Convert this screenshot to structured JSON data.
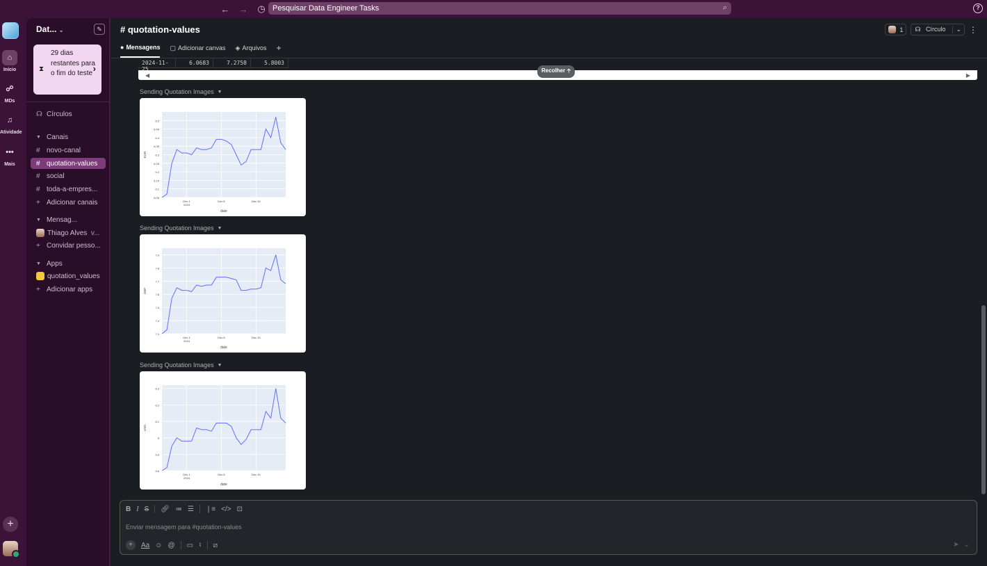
{
  "search": {
    "placeholder": "Pesquisar Data Engineer Tasks"
  },
  "rail": {
    "items": [
      {
        "label": "Início"
      },
      {
        "label": "MDs"
      },
      {
        "label": "Atividade"
      },
      {
        "label": "Mais"
      }
    ]
  },
  "sidebar": {
    "workspace": "Dat...",
    "trial": "29 dias restantes para o fim do teste",
    "huddles": "Círculos",
    "channels_header": "Canais",
    "channels": [
      "novo-canal",
      "quotation-values",
      "social",
      "toda-a-empres..."
    ],
    "add_channels": "Adicionar canais",
    "dms_header": "Mensag...",
    "dm_user": "Thiago Alves",
    "dm_user_suffix": "v...",
    "invite": "Convidar pesso...",
    "apps_header": "Apps",
    "app_name": "quotation_values",
    "add_apps": "Adicionar apps"
  },
  "channel": {
    "name": "quotation-values",
    "member_count": "1",
    "huddle_label": "Círculo",
    "tabs": [
      "Mensagens",
      "Adicionar canvas",
      "Arquivos"
    ]
  },
  "table_row": [
    "2024-11-25",
    "6.0683",
    "7.2758",
    "5.8003"
  ],
  "collapse_label": "Recolher",
  "messages": [
    {
      "label": "Sending Quotation Images"
    },
    {
      "label": "Sending Quotation Images"
    },
    {
      "label": "Sending Quotation Images"
    }
  ],
  "chart_data": [
    {
      "type": "line",
      "xlabel": "date",
      "ylabel": "EUR",
      "x_ticks": [
        "Dec 1\n2024",
        "Dec 8",
        "Dec 15"
      ],
      "y_ticks": [
        "6.05",
        "6.1",
        "6.15",
        "6.2",
        "6.25",
        "6.3",
        "6.35",
        "6.4",
        "6.45",
        "6.5"
      ],
      "ylim": [
        6.05,
        6.55
      ],
      "series": [
        {
          "values": [
            6.05,
            6.07,
            6.25,
            6.33,
            6.31,
            6.31,
            6.3,
            6.34,
            6.33,
            6.33,
            6.34,
            6.39,
            6.39,
            6.38,
            6.36,
            6.3,
            6.24,
            6.26,
            6.33,
            6.33,
            6.33,
            6.45,
            6.4,
            6.52,
            6.37,
            6.33
          ]
        }
      ],
      "line_color": "#636efa"
    },
    {
      "type": "line",
      "xlabel": "date",
      "ylabel": "GBP",
      "x_ticks": [
        "Dec 1\n2024",
        "Dec 8",
        "Dec 15"
      ],
      "y_ticks": [
        "7.3",
        "7.4",
        "7.5",
        "7.6",
        "7.7",
        "7.8",
        "7.9"
      ],
      "ylim": [
        7.3,
        7.95
      ],
      "series": [
        {
          "values": [
            7.3,
            7.33,
            7.57,
            7.65,
            7.63,
            7.63,
            7.62,
            7.67,
            7.66,
            7.67,
            7.67,
            7.73,
            7.73,
            7.73,
            7.72,
            7.71,
            7.63,
            7.63,
            7.64,
            7.64,
            7.65,
            7.8,
            7.78,
            7.9,
            7.71,
            7.68
          ]
        }
      ],
      "line_color": "#636efa"
    },
    {
      "type": "line",
      "xlabel": "date",
      "ylabel": "USD",
      "x_ticks": [
        "Dec 1\n2024",
        "Dec 8",
        "Dec 15"
      ],
      "y_ticks": [
        "5.8",
        "5.9",
        "6",
        "6.1",
        "6.2",
        "6.3"
      ],
      "ylim": [
        5.8,
        6.32
      ],
      "series": [
        {
          "values": [
            5.8,
            5.82,
            5.95,
            6.0,
            5.98,
            5.98,
            5.98,
            6.06,
            6.05,
            6.05,
            6.04,
            6.09,
            6.09,
            6.09,
            6.07,
            6.0,
            5.96,
            5.99,
            6.05,
            6.05,
            6.05,
            6.16,
            6.12,
            6.3,
            6.12,
            6.09
          ]
        }
      ],
      "line_color": "#636efa"
    }
  ],
  "composer": {
    "placeholder": "Enviar mensagem para #quotation-values"
  }
}
